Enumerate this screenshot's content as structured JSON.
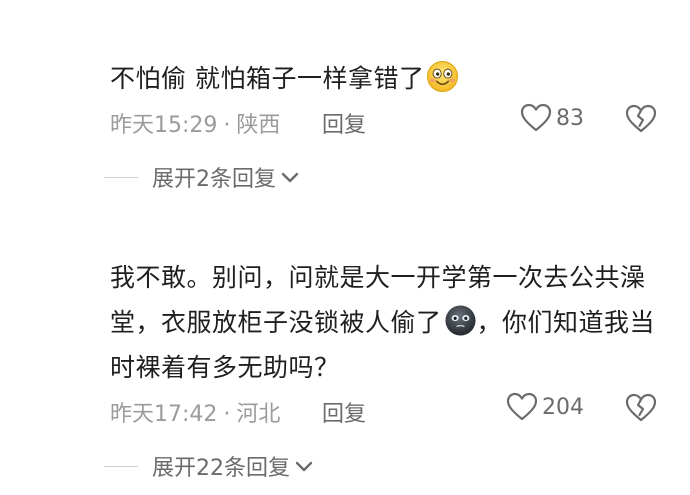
{
  "comments": [
    {
      "text": "不怕偷 就怕箱子一样拿错了",
      "emoji": "smiley-face-emoji",
      "time": "昨天15:29",
      "separator": "·",
      "location": "陕西",
      "reply_label": "回复",
      "likes": "83",
      "expand_label": "展开2条回复"
    },
    {
      "text_part1": "我不敢。别问，问就是大一开学第一次去公共澡堂，衣服放柜子没锁被人偷了",
      "emoji": "dark-face-emoji",
      "text_part2": "，你们知道我当时裸着有多无助吗？",
      "time": "昨天17:42",
      "separator": "·",
      "location": "河北",
      "reply_label": "回复",
      "likes": "204",
      "expand_label": "展开22条回复"
    }
  ],
  "icons": {
    "like": "heart-outline-icon",
    "dislike": "broken-heart-icon",
    "expand": "chevron-down-icon"
  },
  "colors": {
    "text": "#1f1f1f",
    "meta": "#9b9b9b",
    "action": "#6b6b6b",
    "emoji_yellow": "#f7c948"
  }
}
